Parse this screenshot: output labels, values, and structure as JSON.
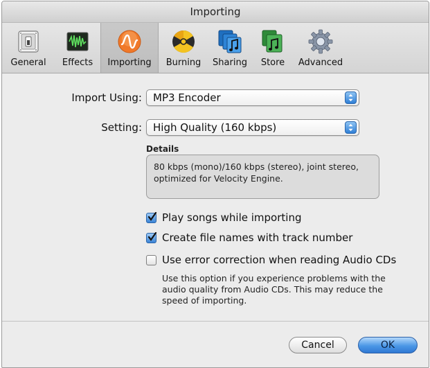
{
  "window": {
    "title": "Importing"
  },
  "toolbar": {
    "items": [
      {
        "label": "General",
        "icon": "general-switch-icon"
      },
      {
        "label": "Effects",
        "icon": "effects-waveform-icon"
      },
      {
        "label": "Importing",
        "icon": "importing-waveform-icon",
        "selected": true
      },
      {
        "label": "Burning",
        "icon": "burning-disc-icon"
      },
      {
        "label": "Sharing",
        "icon": "sharing-music-icon"
      },
      {
        "label": "Store",
        "icon": "store-music-icon"
      },
      {
        "label": "Advanced",
        "icon": "advanced-gear-icon"
      }
    ]
  },
  "import": {
    "import_using_label": "Import Using:",
    "import_using_value": "MP3 Encoder",
    "setting_label": "Setting:",
    "setting_value": "High Quality (160 kbps)"
  },
  "details": {
    "heading": "Details",
    "text": "80 kbps (mono)/160 kbps (stereo), joint stereo, optimized for Velocity Engine."
  },
  "options": [
    {
      "label": "Play songs while importing",
      "checked": true
    },
    {
      "label": "Create file names with track number",
      "checked": true
    },
    {
      "label": "Use error correction when reading Audio CDs",
      "checked": false
    }
  ],
  "help_text": "Use this option if you experience problems with the audio quality from Audio CDs. This may reduce the speed of importing.",
  "buttons": {
    "cancel": "Cancel",
    "ok": "OK"
  },
  "colors": {
    "accent": "#3a84d6",
    "importing_icon": "#f0792a",
    "window_bg": "#ececec"
  }
}
